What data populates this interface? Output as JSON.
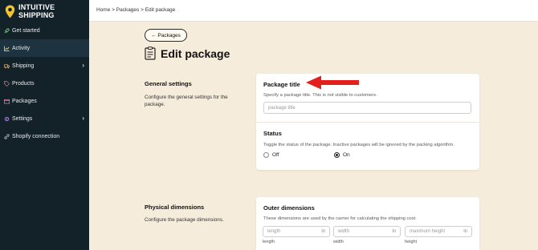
{
  "logo": {
    "line1": "INTUITIVE",
    "line2": "SHIPPING"
  },
  "sidebar": {
    "items": [
      {
        "label": "Get started",
        "icon": "rocket-icon"
      },
      {
        "label": "Activity",
        "icon": "activity-chart-icon",
        "active": true
      },
      {
        "label": "Shipping",
        "icon": "truck-icon",
        "has_children": true
      },
      {
        "label": "Products",
        "icon": "tag-icon"
      },
      {
        "label": "Packages",
        "icon": "box-icon"
      },
      {
        "label": "Settings",
        "icon": "gear-icon",
        "has_children": true
      },
      {
        "label": "Shopify connection",
        "icon": "link-icon"
      }
    ]
  },
  "breadcrumb": "Home > Packages > Edit package",
  "back_button": "← Packages",
  "page_title": "Edit package",
  "general": {
    "title": "General settings",
    "description": "Configure the general settings for the package.",
    "package_title_label": "Package title",
    "package_title_help": "Specify a package title. This is not visible to customers.",
    "package_title_placeholder": "package title",
    "status_label": "Status",
    "status_help": "Toggle the status of the package. Inactive packages will be ignored by the packing algorithm.",
    "status_options": [
      {
        "label": "Off",
        "checked": false
      },
      {
        "label": "On",
        "checked": true
      }
    ]
  },
  "physical": {
    "title": "Physical dimensions",
    "description": "Configure the package dimensions.",
    "outer_label": "Outer dimensions",
    "outer_help": "These dimensions are used by the carrier for calculating the shipping cost.",
    "fields": [
      {
        "placeholder": "length",
        "unit": "in",
        "label": "length"
      },
      {
        "placeholder": "width",
        "unit": "in",
        "label": "width"
      },
      {
        "placeholder": "maximum height",
        "unit": "in",
        "label": "height"
      }
    ]
  },
  "colors": {
    "sidebar_bg": "#132129",
    "content_bg": "#f6ecdb",
    "logo_accent": "#f2c230",
    "annotation_arrow": "#e3201b"
  }
}
